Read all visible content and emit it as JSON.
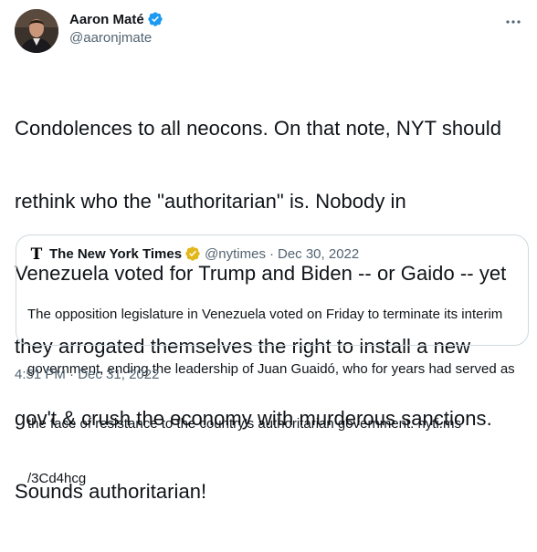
{
  "author": {
    "display_name": "Aaron Maté",
    "handle": "@aaronjmate",
    "verified_color": "#1d9bf0"
  },
  "tweet": {
    "text_lines": [
      "Condolences to all neocons. On that note, NYT should",
      "rethink who the \"authoritarian\" is. Nobody in",
      "Venezuela voted for Trump and Biden -- or Gaido -- yet",
      "they arrogated themselves the right to install a new",
      "gov't & crush the economy with murderous sanctions.",
      "Sounds authoritarian!"
    ],
    "time": "4:51 PM",
    "separator": "·",
    "date": "Dec 31, 2022"
  },
  "quoted_tweet": {
    "display_name": "The New York Times",
    "handle": "@nytimes",
    "separator": "·",
    "date": "Dec 30, 2022",
    "badge_color": "#e2b719",
    "text_lines": [
      "The opposition legislature in Venezuela voted on Friday to terminate its interim",
      "government, ending the leadership of Juan Guaidó, who for years had served as",
      "the face of resistance to the country’s authoritarian government. nyti.ms",
      "/3Cd4hcg"
    ]
  },
  "icons": {
    "verified": "verified-badge-icon",
    "more": "more-options-icon",
    "nyt_logo": "nyt-logo-icon",
    "gold_check": "gold-verified-badge-icon"
  }
}
